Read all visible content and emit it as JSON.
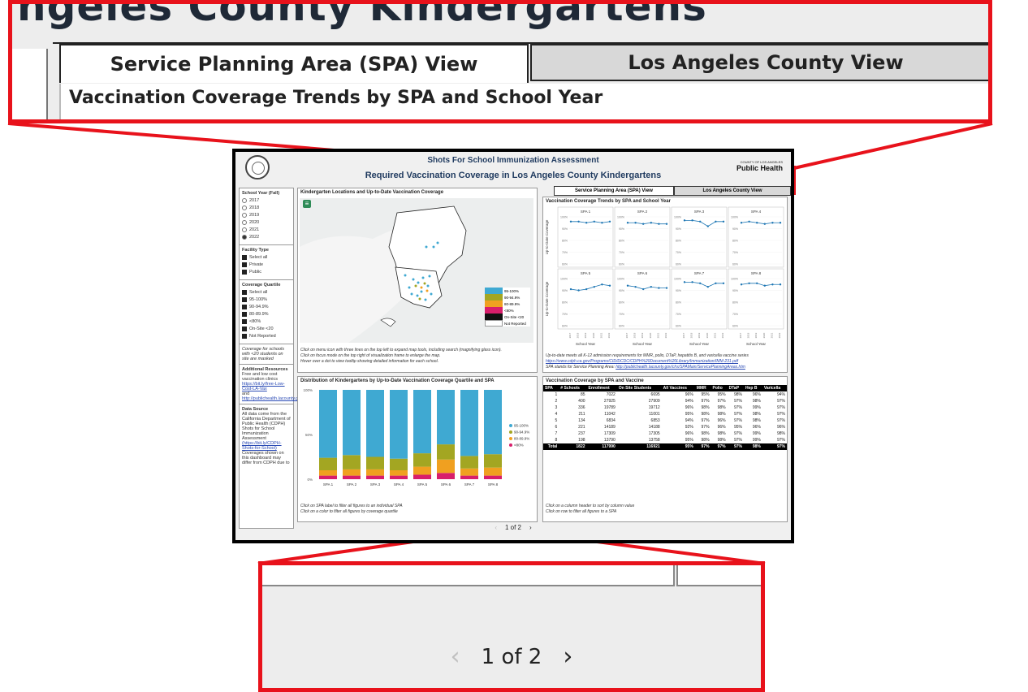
{
  "zoom_top": {
    "big_title": "ngeles County Kindergartens",
    "tab_spa": "Service Planning Area (SPA) View",
    "tab_county": "Los Angeles County View",
    "section_title": "Vaccination Coverage Trends by SPA and School Year"
  },
  "dashboard": {
    "title1": "Shots For School Immunization Assessment",
    "title2": "Required Vaccination Coverage in Los Angeles County Kindergartens",
    "logo_top": "COUNTY OF LOS ANGELES",
    "logo": "Public Health",
    "tab_spa": "Service Planning Area (SPA) View",
    "tab_county": "Los Angeles County View",
    "sidebar": {
      "year_title": "School Year (Fall)",
      "years": [
        "2017",
        "2018",
        "2019",
        "2020",
        "2021",
        "2022"
      ],
      "facility_title": "Facility Type",
      "facility": [
        "Select all",
        "Private",
        "Public"
      ],
      "quartile_title": "Coverage Quartile",
      "quartiles": [
        "Select all",
        "95-100%",
        "90-94.9%",
        "80-89.9%",
        "<80%",
        "On-Site <20",
        "Not Reported"
      ],
      "note": "Coverage for schools with <20 students on site are masked",
      "resources_title": "Additional Resources",
      "resources_text": "Free and low cost vaccination clinics",
      "resources_link1": "https://bit.ly/free-Low-Cost-LA-Vax",
      "resources_and": "and",
      "resources_link2": "http://publichealth.lacounty.gov/vaccinate.htm",
      "source_title": "Data Source",
      "source_text": "All data come from the California Department of Public Health (CDPH) Shots for School Immunization Assessment",
      "source_link": "(https://bit.ly/CDPH-Shots-for-School)",
      "source_text2": "Coverages shown on this dashboard may differ from CDPH due to"
    },
    "map_panel": {
      "title": "Kindergarten Locations and Up-to-Date Vaccination Coverage",
      "legend": [
        "95-100%",
        "90-94.9%",
        "80-89.9%",
        "<80%",
        "On-Site <20",
        "Not Reported"
      ],
      "note1": "Click on menu icon with three lines on the top left to expand map tools, including search (magnifying glass icon).",
      "note2": "Click on focus mode on the top right of visualization frame to enlarge the map.",
      "note3": "Hover over a dot to view tooltip showing detailed information for each school."
    },
    "trends_panel": {
      "title": "Vaccination Coverage Trends by SPA and School Year",
      "spas": [
        "SPA 1",
        "SPA 2",
        "SPA 3",
        "SPA 4",
        "SPA 5",
        "SPA 6",
        "SPA 7",
        "SPA 8"
      ],
      "ylabel": "Up-to-Date Coverage",
      "xlabel": "School Year",
      "yticks": [
        "100%",
        "90%",
        "80%",
        "70%",
        "60%"
      ],
      "note1": "Up-to-date meets all K-12 admission requirements for MMR, polio, DTaP, hepatitis B, and varicella vaccine series",
      "link1": "https://www.cdph.ca.gov/Programs/CID/DCDC/CDPH%20Document%20Library/Immunization/IMM-231.pdf",
      "note2": "SPA stands for Service Planning Area:",
      "link2": "http://publichealth.lacounty.gov/chs/SPAMain/ServicePlanningAreas.htm"
    },
    "dist_panel": {
      "title": "Distribution of Kindergartens by Up-to-Date Vaccination Coverage Quartile and SPA",
      "yticks": [
        "100%",
        "50%",
        "0%"
      ],
      "legend": [
        "95-100%",
        "90-94.9%",
        "80-89.9%",
        "<80%"
      ],
      "note1": "Click on SPA label to filter all figures to an individual SPA",
      "note2": "Click on a color to filter all figures by coverage quartile"
    },
    "table_panel": {
      "title": "Vaccination Coverage by SPA and Vaccine",
      "headers": [
        "SPA",
        "# Schools",
        "Enrollment",
        "On Site Students",
        "All Vaccines",
        "MMR",
        "Polio",
        "DTaP",
        "Hep B",
        "Varicella"
      ],
      "rows": [
        [
          "1",
          "85",
          "7022",
          "6695",
          "96%",
          "95%",
          "95%",
          "98%",
          "96%",
          "94%"
        ],
        [
          "2",
          "400",
          "27925",
          "27909",
          "94%",
          "97%",
          "97%",
          "97%",
          "98%",
          "97%"
        ],
        [
          "3",
          "336",
          "19789",
          "19712",
          "96%",
          "98%",
          "98%",
          "97%",
          "99%",
          "97%"
        ],
        [
          "4",
          "211",
          "11042",
          "11001",
          "95%",
          "98%",
          "98%",
          "97%",
          "98%",
          "97%"
        ],
        [
          "5",
          "134",
          "6834",
          "6853",
          "94%",
          "97%",
          "96%",
          "97%",
          "98%",
          "97%"
        ],
        [
          "6",
          "221",
          "14189",
          "14188",
          "92%",
          "97%",
          "96%",
          "95%",
          "96%",
          "96%"
        ],
        [
          "7",
          "237",
          "17309",
          "17305",
          "96%",
          "98%",
          "98%",
          "97%",
          "99%",
          "98%"
        ],
        [
          "8",
          "198",
          "13790",
          "13758",
          "95%",
          "98%",
          "98%",
          "97%",
          "99%",
          "97%"
        ]
      ],
      "total": [
        "Total",
        "1822",
        "117990",
        "116921",
        "95%",
        "97%",
        "97%",
        "97%",
        "98%",
        "97%"
      ],
      "note1": "Click on a column header to sort by column value",
      "note2": "Click on row to filter all figures to a SPA"
    },
    "pager": "1 of 2"
  },
  "zoom_bottom": {
    "pager": "1 of 2"
  },
  "chart_data": [
    {
      "type": "line",
      "title": "Vaccination Coverage Trends by SPA and School Year",
      "xlabel": "School Year",
      "ylabel": "Up-to-Date Coverage",
      "x": [
        "2017",
        "2018",
        "2019",
        "2020",
        "2021",
        "2022"
      ],
      "ylim": [
        60,
        100
      ],
      "series": [
        {
          "name": "SPA 1",
          "values": [
            96,
            96,
            95,
            96,
            95,
            96
          ]
        },
        {
          "name": "SPA 2",
          "values": [
            95,
            95,
            94,
            95,
            94,
            94
          ]
        },
        {
          "name": "SPA 3",
          "values": [
            97,
            97,
            96,
            92,
            96,
            96
          ]
        },
        {
          "name": "SPA 4",
          "values": [
            95,
            96,
            95,
            94,
            95,
            95
          ]
        },
        {
          "name": "SPA 5",
          "values": [
            91,
            90,
            91,
            93,
            95,
            94
          ]
        },
        {
          "name": "SPA 6",
          "values": [
            94,
            93,
            91,
            93,
            92,
            92
          ]
        },
        {
          "name": "SPA 7",
          "values": [
            97,
            97,
            96,
            93,
            96,
            96
          ]
        },
        {
          "name": "SPA 8",
          "values": [
            95,
            96,
            96,
            94,
            95,
            95
          ]
        }
      ]
    },
    {
      "type": "bar",
      "title": "Distribution of Kindergartens by Up-to-Date Vaccination Coverage Quartile and SPA",
      "ylim": [
        0,
        100
      ],
      "series": [
        {
          "name": "95-100%",
          "values": [
            76,
            73,
            75,
            77,
            71,
            61,
            74,
            72
          ]
        },
        {
          "name": "90-94.9%",
          "values": [
            14,
            16,
            14,
            13,
            15,
            17,
            14,
            15
          ]
        },
        {
          "name": "80-89.9%",
          "values": [
            6,
            7,
            7,
            6,
            9,
            15,
            8,
            9
          ]
        },
        {
          "name": "<80%",
          "values": [
            4,
            4,
            4,
            4,
            5,
            7,
            4,
            4
          ]
        }
      ],
      "colors": [
        "#3fa9d2",
        "#a3a622",
        "#f0a020",
        "#d81e6b"
      ]
    }
  ]
}
